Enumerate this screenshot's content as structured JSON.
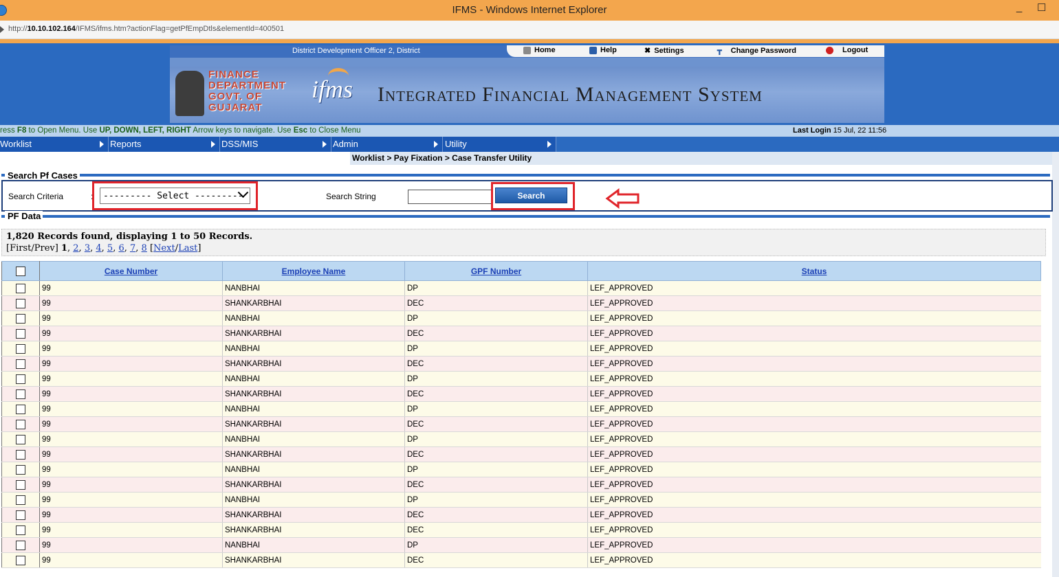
{
  "browser": {
    "title": "IFMS - Windows Internet Explorer",
    "url_prefix": "http://",
    "url_host": "10.10.102.164",
    "url_path": "/IFMS/ifms.htm?actionFlag=getPfEmpDtls&elementId=400501",
    "minimize": "_",
    "restore": "☐"
  },
  "header": {
    "office": "District Development Officer 2, District",
    "links": {
      "home": "Home",
      "help": "Help",
      "settings": "Settings",
      "change_password": "Change Password",
      "logout": "Logout"
    },
    "finance_line1": "FINANCE",
    "finance_line2": "DEPARTMENT",
    "finance_line3": "GOVT. OF",
    "finance_line4": "GUJARAT",
    "logo_text": "ifms",
    "system_name": "Integrated Financial Management System"
  },
  "infobar": {
    "hint_pre": "ress ",
    "hint_f8": "F8",
    "hint_mid1": " to Open Menu. Use ",
    "hint_keys": "UP, DOWN, LEFT, RIGHT",
    "hint_mid2": " Arrow keys to navigate. Use ",
    "hint_esc": "Esc",
    "hint_end": " to Close Menu",
    "last_login_label": "Last Login",
    "last_login_value": "15 Jul, 22 11:56"
  },
  "menu": {
    "worklist": "Worklist",
    "reports": "Reports",
    "dss": "DSS/MIS",
    "admin": "Admin",
    "utility": "Utility"
  },
  "breadcrumb": "Worklist  > Pay Fixation  > Case Transfer Utility",
  "search": {
    "legend": "Search Pf Cases",
    "criteria_label": "Search Criteria",
    "criteria_colon": ":",
    "criteria_value": "--------- Select ---------",
    "string_label": "Search String",
    "string_value": "",
    "button": "Search"
  },
  "pf": {
    "legend": "PF Data",
    "records_text": "1,820 Records found, displaying 1 to 50 Records.",
    "pager_open": "[First/Prev] ",
    "current_page": "1",
    "pages": [
      "2",
      "3",
      "4",
      "5",
      "6",
      "7",
      "8"
    ],
    "next_last_pre": " [",
    "next": "Next",
    "slash": "/",
    "last": "Last",
    "close": "]"
  },
  "table": {
    "headers": [
      "Case Number",
      "Employee Name",
      "GPF Number",
      "Status"
    ],
    "rows": [
      {
        "case": "99",
        "name": "NANBHAI",
        "gpf": "DP",
        "status": "LEF_APPROVED"
      },
      {
        "case": "99",
        "name": "SHANKARBHAI",
        "gpf": "DEC",
        "status": "LEF_APPROVED"
      },
      {
        "case": "99",
        "name": "NANBHAI",
        "gpf": "DP",
        "status": "LEF_APPROVED"
      },
      {
        "case": "99",
        "name": "SHANKARBHAI",
        "gpf": "DEC",
        "status": "LEF_APPROVED"
      },
      {
        "case": "99",
        "name": "NANBHAI",
        "gpf": "DP",
        "status": "LEF_APPROVED"
      },
      {
        "case": "99",
        "name": "SHANKARBHAI",
        "gpf": "DEC",
        "status": "LEF_APPROVED"
      },
      {
        "case": "99",
        "name": "NANBHAI",
        "gpf": "DP",
        "status": "LEF_APPROVED"
      },
      {
        "case": "99",
        "name": "SHANKARBHAI",
        "gpf": "DEC",
        "status": "LEF_APPROVED"
      },
      {
        "case": "99",
        "name": "NANBHAI",
        "gpf": "DP",
        "status": "LEF_APPROVED"
      },
      {
        "case": "99",
        "name": "SHANKARBHAI",
        "gpf": "DEC",
        "status": "LEF_APPROVED"
      },
      {
        "case": "99",
        "name": "NANBHAI",
        "gpf": "DP",
        "status": "LEF_APPROVED"
      },
      {
        "case": "99",
        "name": "SHANKARBHAI",
        "gpf": "DEC",
        "status": "LEF_APPROVED"
      },
      {
        "case": "99",
        "name": "NANBHAI",
        "gpf": "DP",
        "status": "LEF_APPROVED"
      },
      {
        "case": "99",
        "name": "SHANKARBHAI",
        "gpf": "DEC",
        "status": "LEF_APPROVED"
      },
      {
        "case": "99",
        "name": "NANBHAI",
        "gpf": "DP",
        "status": "LEF_APPROVED"
      },
      {
        "case": "99",
        "name": "SHANKARBHAI",
        "gpf": "DEC",
        "status": "LEF_APPROVED"
      },
      {
        "case": "99",
        "name": "SHANKARBHAI",
        "gpf": "DEC",
        "status": "LEF_APPROVED"
      },
      {
        "case": "99",
        "name": "NANBHAI",
        "gpf": "DP",
        "status": "LEF_APPROVED"
      },
      {
        "case": "99",
        "name": "SHANKARBHAI",
        "gpf": "DEC",
        "status": "LEF_APPROVED"
      }
    ]
  },
  "colors": {
    "titlebar": "#f3a64d",
    "menu": "#1b57b3",
    "highlight": "#e0242a",
    "link": "#1a3fb5"
  }
}
